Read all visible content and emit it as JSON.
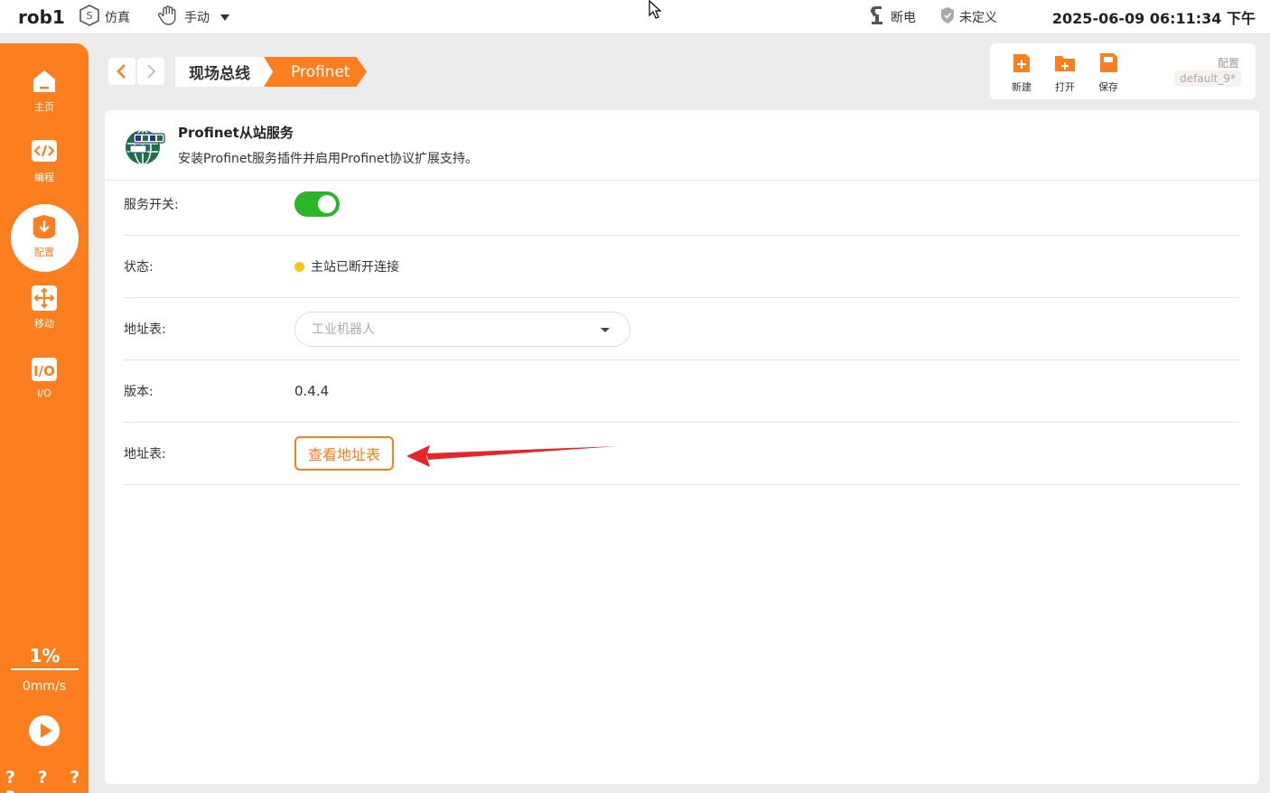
{
  "topbar": {
    "robot_name": "rob1",
    "mode_sim": "仿真",
    "mode_manual": "手动",
    "power_status": "断电",
    "safety_status": "未定义",
    "datetime": "2025-06-09 06:11:34 下午"
  },
  "sidebar": {
    "items": [
      {
        "label": "主页",
        "icon": "home-icon"
      },
      {
        "label": "编程",
        "icon": "code-icon"
      },
      {
        "label": "配置",
        "icon": "config-icon",
        "active": true
      },
      {
        "label": "移动",
        "icon": "move-icon"
      },
      {
        "label": "I/O",
        "icon": "io-icon"
      }
    ],
    "speed_percent": "1%",
    "speed_value": "0mm/s",
    "bottom_marks": "? ? ? ?"
  },
  "breadcrumb": {
    "items": [
      "现场总线",
      "Profinet"
    ]
  },
  "toolbar": {
    "new_label": "新建",
    "open_label": "打开",
    "save_label": "保存",
    "config_label": "配置",
    "config_name": "default_9*"
  },
  "service": {
    "title": "Profinet从站服务",
    "description": "安装Profinet服务插件并启用Profinet协议扩展支持。",
    "rows": {
      "switch_label": "服务开关:",
      "switch_on": true,
      "status_label": "状态:",
      "status_value": "主站已断开连接",
      "address_label": "地址表:",
      "address_value": "工业机器人",
      "version_label": "版本:",
      "version_value": "0.4.4",
      "view_label": "地址表:",
      "view_button": "查看地址表"
    }
  },
  "colors": {
    "accent": "#fd7e1e",
    "toggle_on": "#2bb52b",
    "status_dot": "#f5c518",
    "annotation": "#e8262a"
  }
}
